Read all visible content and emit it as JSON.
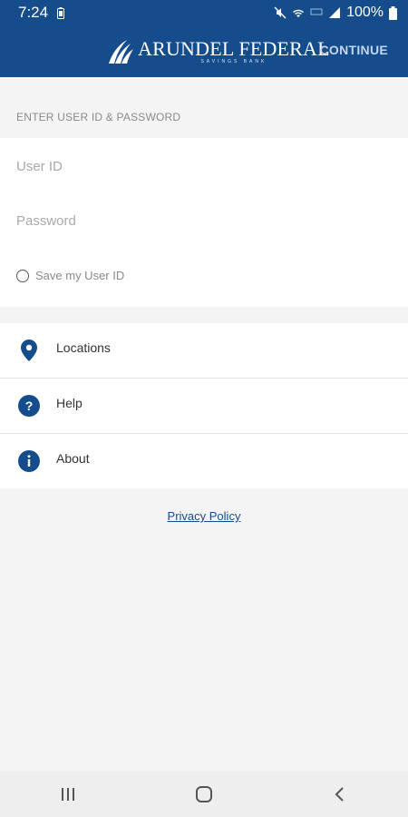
{
  "status_bar": {
    "time": "7:24",
    "battery_percent": "100%",
    "icons": [
      "battery-saver-icon",
      "mute-icon",
      "wifi-icon",
      "lte-icon",
      "signal-icon",
      "battery-icon"
    ]
  },
  "header": {
    "logo_text": "ARUNDEL FEDERAL",
    "logo_subtext": "SAVINGS BANK",
    "continue_label": "CONTINUE"
  },
  "login": {
    "section_label": "ENTER USER ID & PASSWORD",
    "user_id": {
      "value": "",
      "placeholder": "User ID"
    },
    "password": {
      "value": "",
      "placeholder": "Password"
    },
    "save_user_id": {
      "label": "Save my User ID",
      "checked": false
    }
  },
  "menu": {
    "items": [
      {
        "label": "Locations",
        "icon": "location-pin-icon"
      },
      {
        "label": "Help",
        "icon": "help-icon"
      },
      {
        "label": "About",
        "icon": "info-icon"
      }
    ]
  },
  "footer": {
    "privacy_label": "Privacy Policy"
  },
  "nav_bar": {
    "buttons": [
      "recent-apps-icon",
      "home-icon",
      "back-icon"
    ]
  },
  "colors": {
    "brand": "#154c8c",
    "background": "#f4f4f4",
    "card": "#ffffff"
  }
}
